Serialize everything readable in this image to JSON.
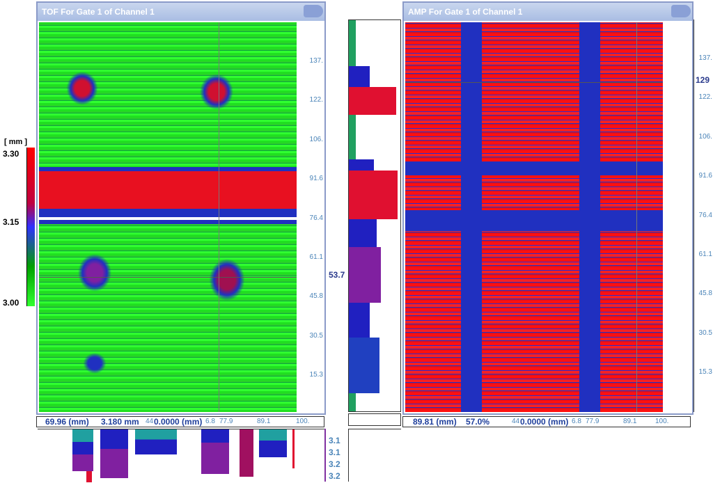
{
  "tof": {
    "title": "TOF For Gate 1 of Channel 1",
    "y_ticks": [
      "137.",
      "122.",
      "106.",
      "91.6",
      "76.4",
      "61.1",
      "45.8",
      "30.5",
      "15.3"
    ],
    "cursor_value": "53.7",
    "readout": {
      "x": "69.96 (mm)",
      "value": "3.180 mm",
      "offset": "0.0000 (mm)"
    },
    "x_ticks": [
      "44",
      "6.8",
      "77.9",
      "89.1",
      "100."
    ]
  },
  "amp": {
    "title": "AMP For Gate 1 of Channel 1",
    "y_ticks": [
      "137.",
      "122.",
      "106.",
      "91.6",
      "76.4",
      "61.1",
      "45.8",
      "30.5",
      "15.3"
    ],
    "cursor_value": "129",
    "readout": {
      "x": "89.81 (mm)",
      "value": "57.0%",
      "offset": "0.0000 (mm)"
    },
    "x_ticks": [
      "44",
      "6.8",
      "77.9",
      "89.1",
      "100."
    ]
  },
  "color_scale": {
    "unit": "[ mm ]",
    "labels": [
      "3.30",
      "3.15",
      "3.00"
    ],
    "colors": [
      "#ff0000",
      "#c00040",
      "#3030ff",
      "#00a000",
      "#30ff30"
    ]
  },
  "bottom_profile": {
    "labels": [
      "3.1",
      "3.1",
      "3.2",
      "3.2"
    ]
  },
  "colors": {
    "red": "#ff1010",
    "blue": "#2020c0",
    "green": "#20ff20",
    "teal": "#20a0a0",
    "text_blue": "#1f3f9c",
    "tick_blue": "#4a84b8"
  }
}
